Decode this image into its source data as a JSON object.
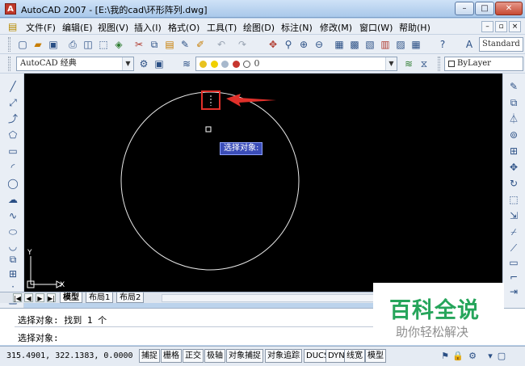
{
  "window": {
    "title": "AutoCAD 2007 - [E:\\我的cad\\环形阵列.dwg]",
    "minimize": "–",
    "maximize": "□",
    "close": "✕"
  },
  "menu": {
    "items": [
      "文件(F)",
      "编辑(E)",
      "视图(V)",
      "插入(I)",
      "格式(O)",
      "工具(T)",
      "绘图(D)",
      "标注(N)",
      "修改(M)",
      "窗口(W)",
      "帮助(H)"
    ],
    "doc_min": "–",
    "doc_max": "▫",
    "doc_close": "×"
  },
  "toolbar": {
    "text_style": "Standard"
  },
  "toolbar2": {
    "workspace": "AutoCAD 经典",
    "layer": "0",
    "bylayer": "ByLayer"
  },
  "canvas": {
    "tooltip": "选择对象:",
    "ucs_x": "X",
    "ucs_y": "Y"
  },
  "tabs": {
    "model": "模型",
    "layout1": "布局1",
    "layout2": "布局2"
  },
  "command": {
    "line1": "选择对象: 找到 1 个",
    "line2": "选择对象:"
  },
  "watermark": {
    "title": "百科全说",
    "subtitle": "助你轻松解决"
  },
  "status": {
    "coords": "315.4901, 322.1383, 0.0000",
    "buttons": [
      "捕捉",
      "栅格",
      "正交",
      "极轴",
      "对象捕捉",
      "对象追踪",
      "DUCS",
      "DYN",
      "线宽",
      "模型"
    ]
  },
  "colors": {
    "canvas_bg": "#000000",
    "highlight": "#e0302a",
    "watermark_green": "#26a55b"
  }
}
